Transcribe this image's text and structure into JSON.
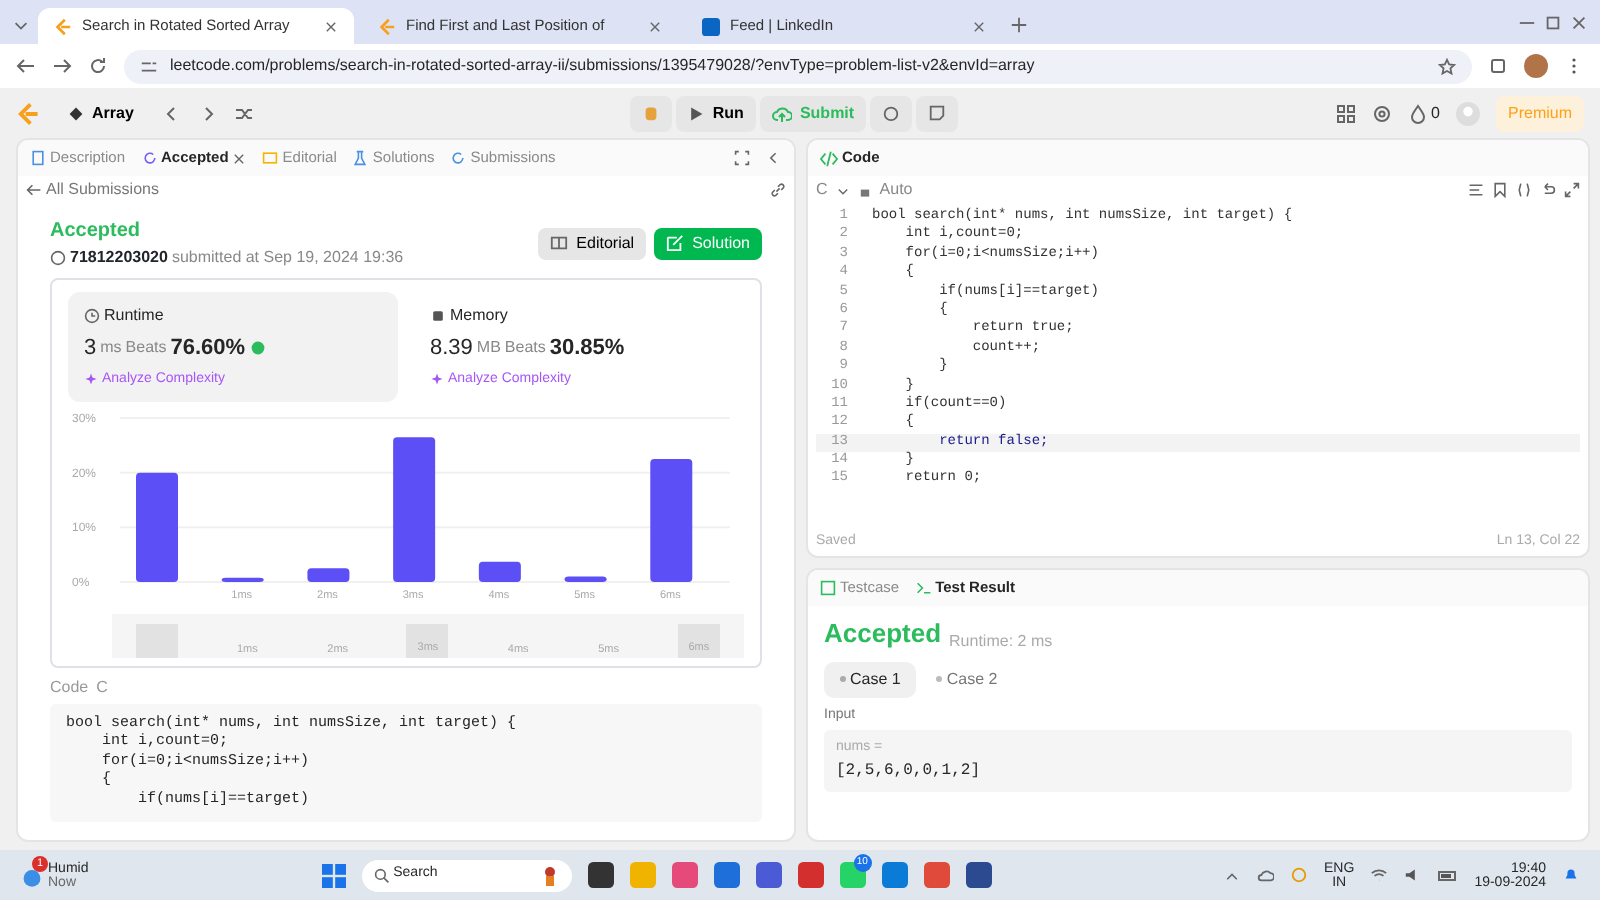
{
  "browser": {
    "tabs": [
      {
        "title": "Search in Rotated Sorted Array",
        "selected": true
      },
      {
        "title": "Find First and Last Position of",
        "selected": false
      },
      {
        "title": "Feed | LinkedIn",
        "selected": false
      }
    ],
    "url": "leetcode.com/problems/search-in-rotated-sorted-array-ii/submissions/1395479028/?envType=problem-list-v2&envId=array"
  },
  "toolbar": {
    "list_name": "Array",
    "run": "Run",
    "submit": "Submit",
    "streak": "0",
    "premium": "Premium"
  },
  "left_panel": {
    "tabs": [
      {
        "label": "Description",
        "selected": false
      },
      {
        "label": "Accepted",
        "selected": true
      },
      {
        "label": "Editorial",
        "selected": false
      },
      {
        "label": "Solutions",
        "selected": false
      },
      {
        "label": "Submissions",
        "selected": false
      }
    ],
    "back_link": "All Submissions",
    "status": "Accepted",
    "user": "71812203020",
    "submitted": "submitted at Sep 19, 2024 19:36",
    "buttons": [
      "Editorial",
      "Solution"
    ],
    "stats": [
      {
        "title": "Runtime",
        "value": "3",
        "unit": "ms",
        "beats_label": "Beats",
        "beats": "76.60%",
        "selected": true,
        "link": "Analyze Complexity"
      },
      {
        "title": "Memory",
        "value": "8.39",
        "unit": "MB",
        "beats_label": "Beats",
        "beats": "30.85%",
        "selected": false,
        "link": "Analyze Complexity"
      }
    ],
    "chart_data": {
      "type": "bar",
      "categories": [
        null,
        "1ms",
        "2ms",
        "3ms",
        "4ms",
        "5ms",
        "6ms"
      ],
      "series": [
        {
          "color": "#5b4ff5",
          "values": [
            20,
            0.8,
            2.5,
            26.5,
            3.7,
            1,
            22.5
          ]
        }
      ],
      "ylim": [
        0,
        30
      ],
      "yticks": [
        {
          "value": 0,
          "label": "0%"
        },
        {
          "value": 10,
          "label": "10%"
        },
        {
          "value": 20,
          "label": "20%"
        },
        {
          "value": 30,
          "label": "30%"
        }
      ]
    },
    "range_slider": {
      "level": 1,
      "items": [
        {
          "selected": true
        },
        {
          "label": "1ms",
          "selected": false
        },
        {
          "label": "2ms",
          "selected": false
        },
        {
          "label": "3ms",
          "selected": true
        },
        {
          "label": "4ms",
          "selected": false
        },
        {
          "label": "5ms",
          "selected": false
        },
        {
          "label": "6ms",
          "selected": true
        }
      ]
    },
    "code_label": "Code",
    "language": "C",
    "code": [
      "bool search(int* nums, int numsSize, int target) {",
      "    int i,count=0;",
      "    for(i=0;i<numsSize;i++)",
      "    {",
      "        if(nums[i]==target)"
    ]
  },
  "editor": {
    "title": "Code",
    "language": "C",
    "mode": "Auto",
    "lines": [
      {
        "no": "1",
        "text": "bool search(int* nums, int numsSize, int target) {",
        "active": false
      },
      {
        "no": "2",
        "text": "    int i,count=0;",
        "active": false
      },
      {
        "no": "3",
        "text": "    for(i=0;i<numsSize;i++)",
        "active": false
      },
      {
        "no": "4",
        "text": "    {",
        "active": false
      },
      {
        "no": "5",
        "text": "        if(nums[i]==target)",
        "active": false
      },
      {
        "no": "6",
        "text": "        {",
        "active": false
      },
      {
        "no": "7",
        "text": "            return true;",
        "active": false
      },
      {
        "no": "8",
        "text": "            count++;",
        "active": false
      },
      {
        "no": "9",
        "text": "        }",
        "active": false
      },
      {
        "no": "10",
        "text": "    }",
        "active": false
      },
      {
        "no": "11",
        "text": "    if(count==0)",
        "active": false
      },
      {
        "no": "12",
        "text": "    {",
        "active": false
      },
      {
        "no": "13",
        "text": "        return false;",
        "active": true
      },
      {
        "no": "14",
        "text": "    }",
        "active": false
      },
      {
        "no": "15",
        "text": "    return 0;",
        "active": false
      }
    ],
    "saved": "Saved",
    "cursor": "Ln 13, Col 22"
  },
  "test_panel": {
    "tabs": [
      {
        "label": "Testcase",
        "selected": false
      },
      {
        "label": "Test Result",
        "selected": true
      }
    ],
    "status": "Accepted",
    "runtime": "Runtime: 2 ms",
    "cases": [
      {
        "label": "Case 1",
        "selected": true
      },
      {
        "label": "Case 2",
        "selected": false
      }
    ],
    "input_label": "Input",
    "param": "nums =",
    "value": "[2,5,6,0,0,1,2]"
  },
  "taskbar": {
    "weather": "Humid",
    "weather_time": "Now",
    "weather_badge": "1",
    "search": "Search",
    "whatsapp_badge": "10",
    "lang": "ENG",
    "region": "IN",
    "time": "19:40",
    "date": "19-09-2024"
  }
}
